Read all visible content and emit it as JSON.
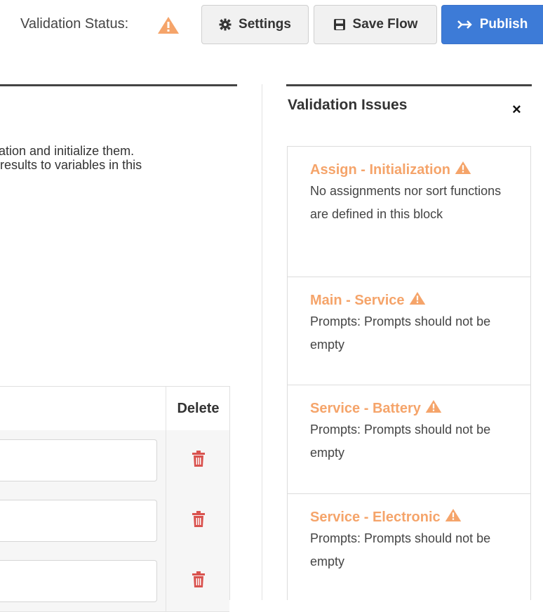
{
  "toolbar": {
    "validation_label": "Validation Status:",
    "settings_label": "Settings",
    "save_label": "Save Flow",
    "publish_label": "Publish"
  },
  "description": {
    "line1": "ation and initialize them.",
    "line2": "results to variables in this"
  },
  "table": {
    "delete_header": "Delete",
    "rows": [
      {
        "value": ""
      },
      {
        "value": ""
      },
      {
        "value": ""
      }
    ]
  },
  "issues_panel": {
    "title": "Validation Issues",
    "close": "×",
    "items": [
      {
        "title": "Assign - Initialization",
        "message": "No assignments nor sort functions are defined in this block"
      },
      {
        "title": "Main - Service",
        "message": "Prompts: Prompts should not be empty"
      },
      {
        "title": "Service - Battery",
        "message": "Prompts: Prompts should not be empty"
      },
      {
        "title": "Service - Electronic",
        "message": "Prompts: Prompts should not be empty"
      }
    ]
  },
  "colors": {
    "warning": "#f5a46a",
    "publish_bg": "#3d7bd7",
    "delete_icon": "#d9534f"
  },
  "icons": {
    "validation": "warning-triangle-icon",
    "settings": "gear-icon",
    "save": "floppy-disk-icon",
    "publish": "publish-arrow-icon",
    "delete": "trash-icon",
    "close": "close-icon"
  }
}
